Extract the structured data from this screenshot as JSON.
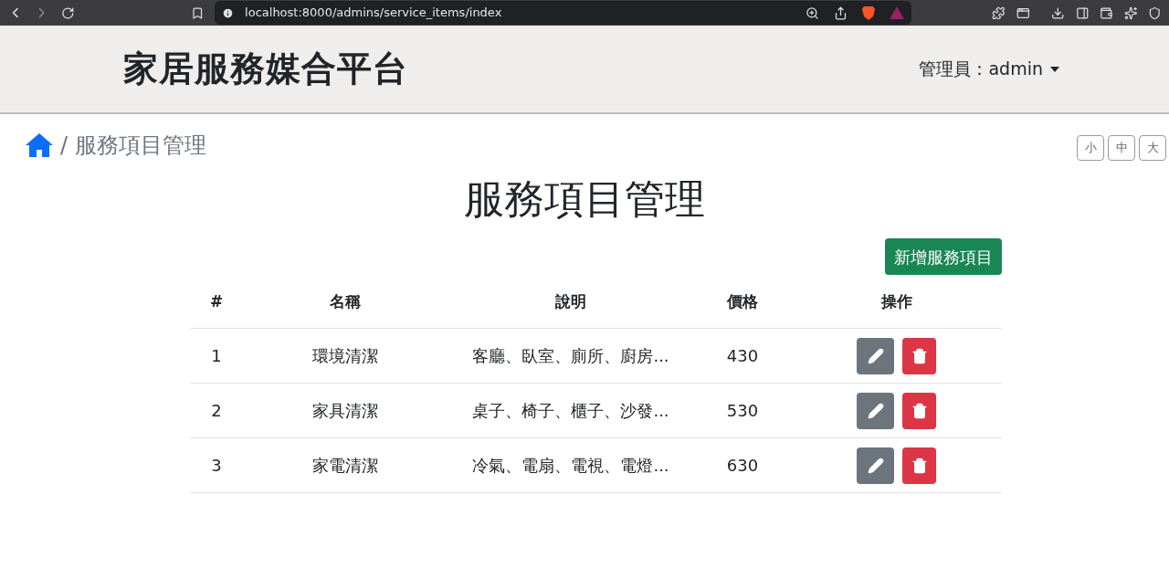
{
  "browser": {
    "url": "localhost:8000/admins/service_items/index"
  },
  "header": {
    "title": "家居服務媒合平台",
    "user_menu": "管理員：admin"
  },
  "breadcrumb": {
    "separator": "/",
    "current": "服務項目管理"
  },
  "font_size_buttons": [
    "小",
    "中",
    "大"
  ],
  "page_title": "服務項目管理",
  "add_button": "新增服務項目",
  "table": {
    "columns": [
      "#",
      "名稱",
      "說明",
      "價格",
      "操作"
    ],
    "rows": [
      {
        "cells": [
          "1",
          "環境清潔",
          "客廳、臥室、廁所、廚房...",
          "430"
        ]
      },
      {
        "cells": [
          "2",
          "家具清潔",
          "桌子、椅子、櫃子、沙發...",
          "530"
        ]
      },
      {
        "cells": [
          "3",
          "家電清潔",
          "冷氣、電扇、電視、電燈...",
          "630"
        ]
      }
    ]
  }
}
